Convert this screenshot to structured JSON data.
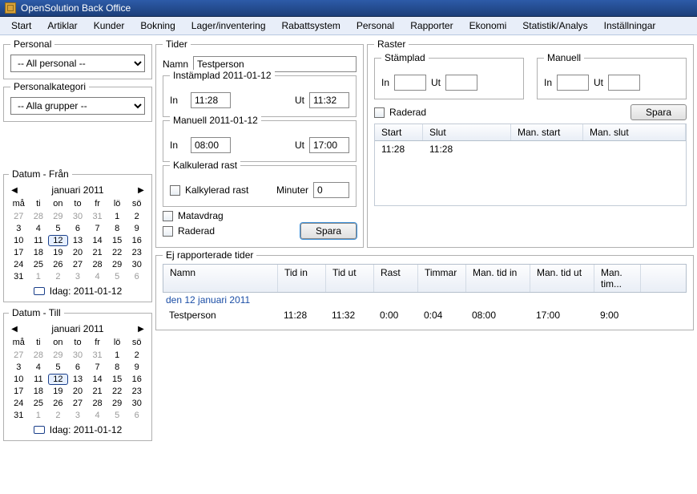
{
  "window": {
    "title": "OpenSolution Back Office"
  },
  "menu": [
    "Start",
    "Artiklar",
    "Kunder",
    "Bokning",
    "Lager/inventering",
    "Rabattsystem",
    "Personal",
    "Rapporter",
    "Ekonomi",
    "Statistik/Analys",
    "Inställningar"
  ],
  "sidebar": {
    "personal": {
      "title": "Personal",
      "value": "-- All personal --"
    },
    "kategori": {
      "title": "Personalkategori",
      "value": "-- Alla grupper --"
    },
    "dateFrom": {
      "title": "Datum - Från",
      "month": "januari 2011",
      "dow": [
        "må",
        "ti",
        "on",
        "to",
        "fr",
        "lö",
        "sö"
      ],
      "cells": [
        {
          "d": "27",
          "o": true
        },
        {
          "d": "28",
          "o": true
        },
        {
          "d": "29",
          "o": true
        },
        {
          "d": "30",
          "o": true
        },
        {
          "d": "31",
          "o": true
        },
        {
          "d": "1"
        },
        {
          "d": "2"
        },
        {
          "d": "3"
        },
        {
          "d": "4"
        },
        {
          "d": "5"
        },
        {
          "d": "6"
        },
        {
          "d": "7"
        },
        {
          "d": "8"
        },
        {
          "d": "9"
        },
        {
          "d": "10"
        },
        {
          "d": "11"
        },
        {
          "d": "12",
          "sel": true
        },
        {
          "d": "13"
        },
        {
          "d": "14"
        },
        {
          "d": "15"
        },
        {
          "d": "16"
        },
        {
          "d": "17"
        },
        {
          "d": "18"
        },
        {
          "d": "19"
        },
        {
          "d": "20"
        },
        {
          "d": "21"
        },
        {
          "d": "22"
        },
        {
          "d": "23"
        },
        {
          "d": "24"
        },
        {
          "d": "25"
        },
        {
          "d": "26"
        },
        {
          "d": "27"
        },
        {
          "d": "28"
        },
        {
          "d": "29"
        },
        {
          "d": "30"
        },
        {
          "d": "31"
        },
        {
          "d": "1",
          "o": true
        },
        {
          "d": "2",
          "o": true
        },
        {
          "d": "3",
          "o": true
        },
        {
          "d": "4",
          "o": true
        },
        {
          "d": "5",
          "o": true
        },
        {
          "d": "6",
          "o": true
        }
      ],
      "today": "Idag: 2011-01-12"
    },
    "dateTo": {
      "title": "Datum - Till",
      "month": "januari 2011",
      "dow": [
        "må",
        "ti",
        "on",
        "to",
        "fr",
        "lö",
        "sö"
      ],
      "cells": [
        {
          "d": "27",
          "o": true
        },
        {
          "d": "28",
          "o": true
        },
        {
          "d": "29",
          "o": true
        },
        {
          "d": "30",
          "o": true
        },
        {
          "d": "31",
          "o": true
        },
        {
          "d": "1"
        },
        {
          "d": "2"
        },
        {
          "d": "3"
        },
        {
          "d": "4"
        },
        {
          "d": "5"
        },
        {
          "d": "6"
        },
        {
          "d": "7"
        },
        {
          "d": "8"
        },
        {
          "d": "9"
        },
        {
          "d": "10"
        },
        {
          "d": "11"
        },
        {
          "d": "12",
          "sel": true
        },
        {
          "d": "13"
        },
        {
          "d": "14"
        },
        {
          "d": "15"
        },
        {
          "d": "16"
        },
        {
          "d": "17"
        },
        {
          "d": "18"
        },
        {
          "d": "19"
        },
        {
          "d": "20"
        },
        {
          "d": "21"
        },
        {
          "d": "22"
        },
        {
          "d": "23"
        },
        {
          "d": "24"
        },
        {
          "d": "25"
        },
        {
          "d": "26"
        },
        {
          "d": "27"
        },
        {
          "d": "28"
        },
        {
          "d": "29"
        },
        {
          "d": "30"
        },
        {
          "d": "31"
        },
        {
          "d": "1",
          "o": true
        },
        {
          "d": "2",
          "o": true
        },
        {
          "d": "3",
          "o": true
        },
        {
          "d": "4",
          "o": true
        },
        {
          "d": "5",
          "o": true
        },
        {
          "d": "6",
          "o": true
        }
      ],
      "today": "Idag: 2011-01-12"
    }
  },
  "tider": {
    "title": "Tider",
    "labels": {
      "namn": "Namn",
      "in": "In",
      "ut": "Ut",
      "minuter": "Minuter"
    },
    "namn": "Testperson",
    "instamplad": {
      "title": "Instämplad 2011-01-12",
      "in": "11:28",
      "ut": "11:32"
    },
    "manuell": {
      "title": "Manuell 2011-01-12",
      "in": "08:00",
      "ut": "17:00"
    },
    "kalk": {
      "title": "Kalkulerad rast",
      "check": "Kalkylerad rast",
      "minuter": "0"
    },
    "matavdrag": "Matavdrag",
    "raderad": "Raderad",
    "spara": "Spara"
  },
  "raster": {
    "title": "Raster",
    "stamplad": {
      "title": "Stämplad",
      "in": "",
      "ut": ""
    },
    "manuell": {
      "title": "Manuell",
      "in": "",
      "ut": ""
    },
    "labels": {
      "in": "In",
      "ut": "Ut"
    },
    "raderad": "Raderad",
    "spara": "Spara",
    "columns": [
      "Start",
      "Slut",
      "Man. start",
      "Man. slut"
    ],
    "rows": [
      {
        "start": "11:28",
        "slut": "11:28",
        "mstart": "",
        "mslut": ""
      }
    ]
  },
  "ej": {
    "title": "Ej rapporterade tider",
    "columns": [
      "Namn",
      "Tid in",
      "Tid ut",
      "Rast",
      "Timmar",
      "Man. tid in",
      "Man. tid ut",
      "Man. tim..."
    ],
    "dateGroup": "den 12 januari 2011",
    "rows": [
      {
        "namn": "Testperson",
        "tidin": "11:28",
        "tidut": "11:32",
        "rast": "0:00",
        "timmar": "0:04",
        "mantidin": "08:00",
        "mantidut": "17:00",
        "mantim": "9:00"
      }
    ]
  }
}
